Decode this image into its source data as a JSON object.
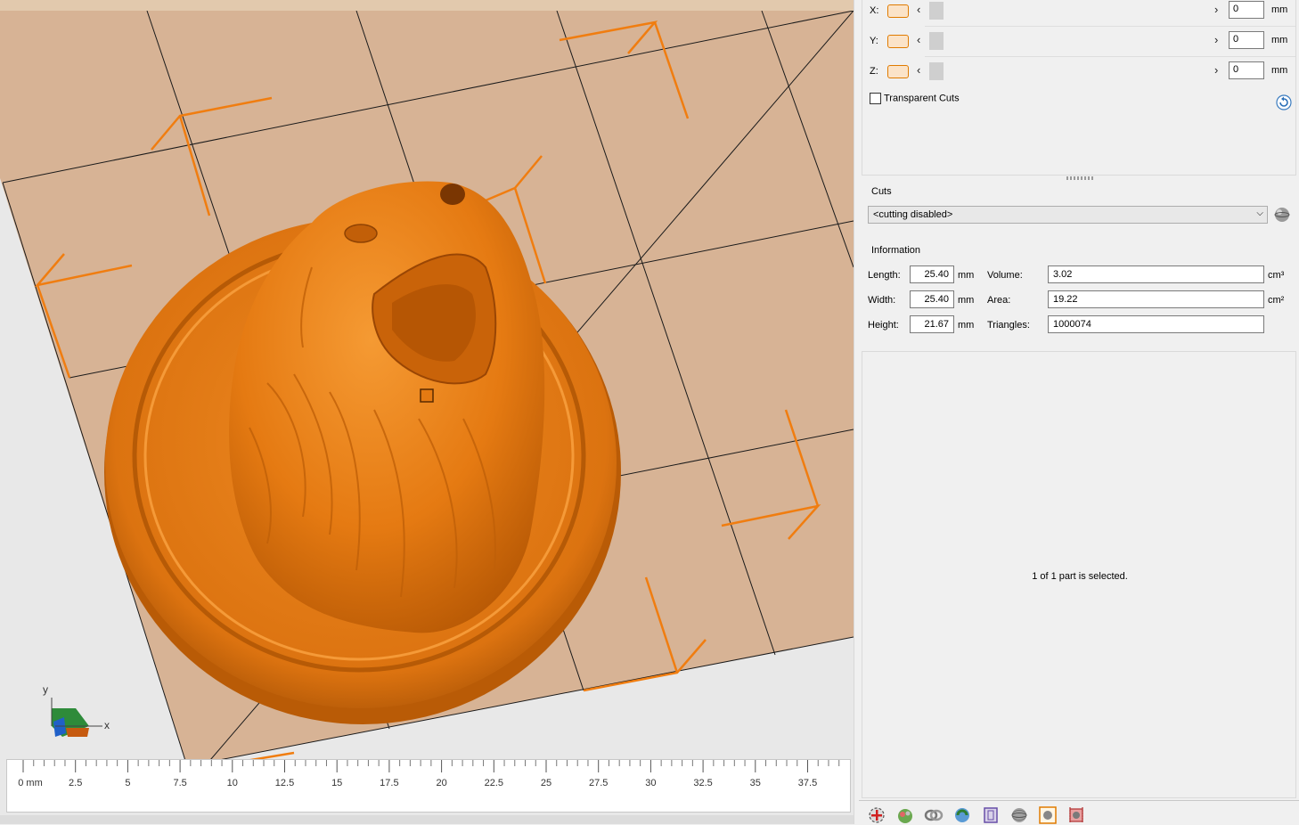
{
  "axes": [
    {
      "name": "X:",
      "value": "0",
      "unit": "mm"
    },
    {
      "name": "Y:",
      "value": "0",
      "unit": "mm"
    },
    {
      "name": "Z:",
      "value": "0",
      "unit": "mm"
    }
  ],
  "transparent_cuts": {
    "label": "Transparent Cuts",
    "checked": false
  },
  "cuts": {
    "title": "Cuts",
    "selected": "<cutting disabled>"
  },
  "information": {
    "title": "Information",
    "length": {
      "label": "Length:",
      "value": "25.40",
      "unit": "mm"
    },
    "width": {
      "label": "Width:",
      "value": "25.40",
      "unit": "mm"
    },
    "height": {
      "label": "Height:",
      "value": "21.67",
      "unit": "mm"
    },
    "volume": {
      "label": "Volume:",
      "value": "3.02",
      "unit": "cm³"
    },
    "area": {
      "label": "Area:",
      "value": "19.22",
      "unit": "cm²"
    },
    "triangles": {
      "label": "Triangles:",
      "value": "1000074"
    }
  },
  "status_text": "1 of 1 part is selected.",
  "ruler": {
    "ticks": [
      "0 mm",
      "2.5",
      "5",
      "7.5",
      "10",
      "12.5",
      "15",
      "17.5",
      "20",
      "22.5",
      "25",
      "27.5",
      "30",
      "32.5",
      "35",
      "37.5"
    ]
  },
  "axis_gizmo": {
    "y_label": "y",
    "x_label": "x"
  },
  "colors": {
    "model": "#e8790e",
    "platform": "#d7b395",
    "accent": "#e07b00",
    "background": "#e8e8e8"
  },
  "toolbar_icons": [
    "add-part-icon",
    "color-icon",
    "link-icon",
    "cycle-icon",
    "frame-icon",
    "sphere-icon",
    "box-select-icon",
    "cut-icon"
  ]
}
